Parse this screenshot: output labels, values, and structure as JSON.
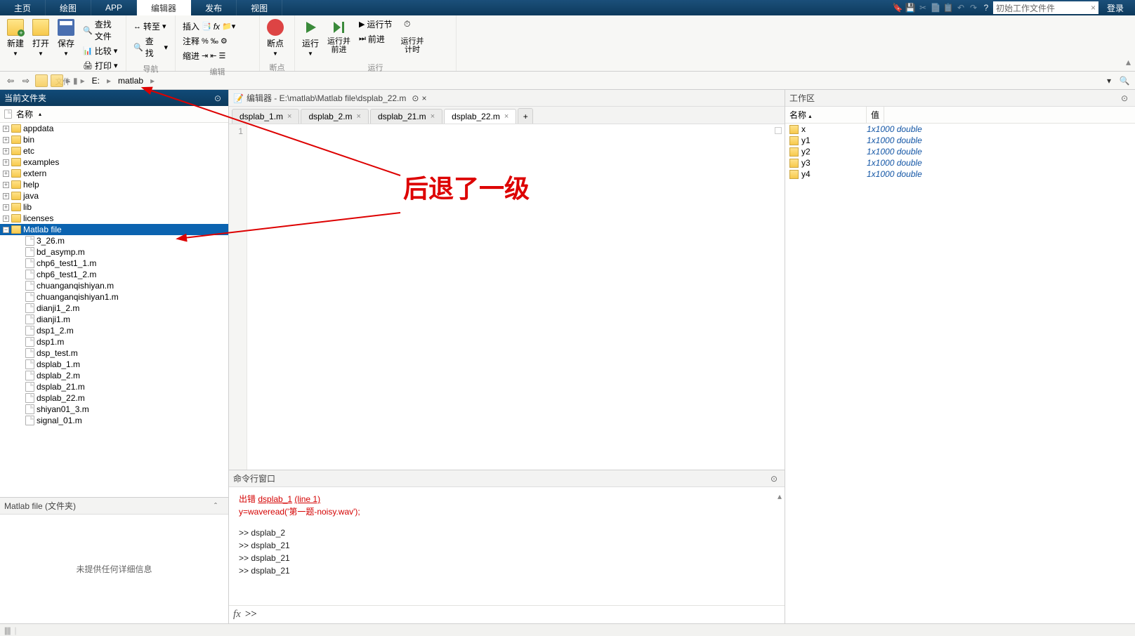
{
  "menubar": {
    "tabs": [
      "主页",
      "绘图",
      "APP",
      "编辑器",
      "发布",
      "视图"
    ],
    "active": 3,
    "search_placeholder": "初始工作文件件",
    "login": "登录"
  },
  "ribbon": {
    "file": {
      "new": "新建",
      "open": "打开",
      "save": "保存",
      "findfiles": "查找文件",
      "compare": "比较",
      "print": "打印",
      "label": "文件"
    },
    "nav": {
      "goto": "转至",
      "find": "查找",
      "label": "导航"
    },
    "edit": {
      "insert": "插入",
      "comment": "注释",
      "indent": "缩进",
      "label": "编辑"
    },
    "bp": {
      "bp": "断点",
      "label": "断点"
    },
    "run": {
      "run": "运行",
      "runadv": "运行并\n前进",
      "runsec": "运行节",
      "advance": "前进",
      "runtime": "运行并\n计时",
      "label": "运行"
    }
  },
  "addr": {
    "drive": "E:",
    "folder": "matlab"
  },
  "folder_panel": {
    "title": "当前文件夹",
    "col": "名称",
    "folders": [
      "appdata",
      "bin",
      "etc",
      "examples",
      "extern",
      "help",
      "java",
      "lib",
      "licenses",
      "Matlab file"
    ],
    "selected": "Matlab file",
    "files": [
      "3_26.m",
      "bd_asymp.m",
      "chp6_test1_1.m",
      "chp6_test1_2.m",
      "chuanganqishiyan.m",
      "chuanganqishiyan1.m",
      "dianji1_2.m",
      "dianji1.m",
      "dsp1_2.m",
      "dsp1.m",
      "dsp_test.m",
      "dsplab_1.m",
      "dsplab_2.m",
      "dsplab_21.m",
      "dsplab_22.m",
      "shiyan01_3.m",
      "signal_01.m"
    ],
    "detail_title": "Matlab file  (文件夹)",
    "detail_empty": "未提供任何详细信息"
  },
  "editor": {
    "title": "编辑器 - E:\\matlab\\Matlab file\\dsplab_22.m",
    "tabs": [
      "dsplab_1.m",
      "dsplab_2.m",
      "dsplab_21.m",
      "dsplab_22.m"
    ],
    "active": 3,
    "line_no": "1"
  },
  "cmd": {
    "title": "命令行窗口",
    "err1_pre": "出错 ",
    "err1_file": "dsplab_1",
    "err1_line": "(line 1)",
    "err2": "y=waveread('第一题-noisy.wav');",
    "lines": [
      ">>  dsplab_2",
      ">>  dsplab_21",
      ">>  dsplab_21",
      ">>  dsplab_21"
    ],
    "prompt": ">>"
  },
  "workspace": {
    "title": "工作区",
    "col_name": "名称",
    "col_val": "值",
    "vars": [
      {
        "n": "x",
        "v": "1x1000 double"
      },
      {
        "n": "y1",
        "v": "1x1000 double"
      },
      {
        "n": "y2",
        "v": "1x1000 double"
      },
      {
        "n": "y3",
        "v": "1x1000 double"
      },
      {
        "n": "y4",
        "v": "1x1000 double"
      }
    ]
  },
  "annotation": "后退了一级"
}
